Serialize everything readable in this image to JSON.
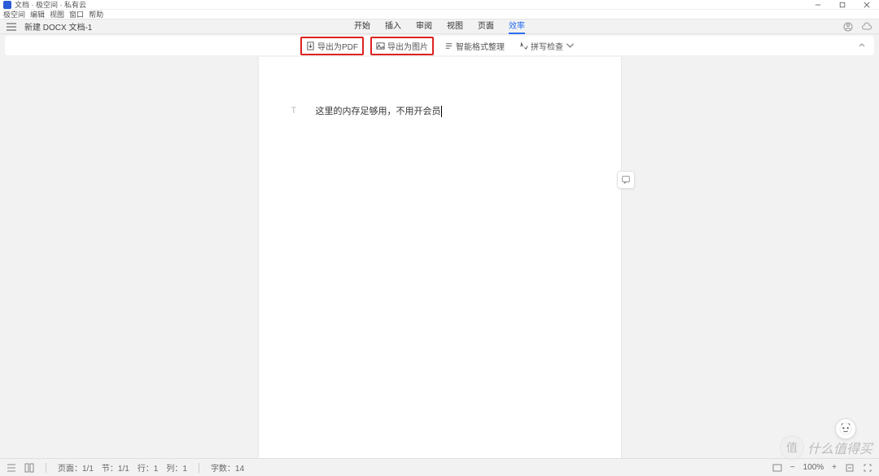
{
  "window": {
    "title": "文档 · 极空间 · 私有云"
  },
  "menu": {
    "items": [
      "极空间",
      "编辑",
      "视图",
      "窗口",
      "帮助"
    ]
  },
  "doc": {
    "name": "新建 DOCX 文档-1"
  },
  "tabs": {
    "items": [
      "开始",
      "插入",
      "审阅",
      "视图",
      "页面",
      "效率"
    ],
    "active_index": 5
  },
  "toolbar": {
    "export_pdf": "导出为PDF",
    "export_image": "导出为图片",
    "smart_format": "智能格式整理",
    "spell_check": "拼写检查"
  },
  "document": {
    "body_text": "这里的内存足够用，不用开会员"
  },
  "status": {
    "page": "页面：1/1",
    "section": "节：1/1",
    "line": "行：1",
    "column": "列：1",
    "word_count": "字数：14",
    "zoom": "100%"
  },
  "watermark": {
    "circle": "值",
    "text": "什么值得买"
  }
}
